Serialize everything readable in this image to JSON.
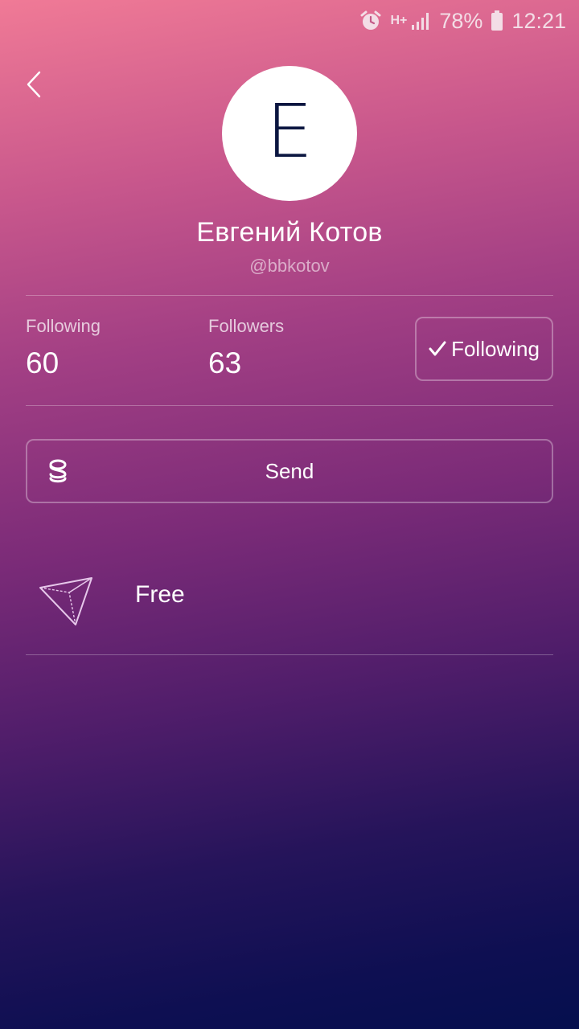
{
  "status_bar": {
    "network": "H+",
    "battery_percent": "78%",
    "time": "12:21"
  },
  "profile": {
    "avatar_initial": "E",
    "name": "Евгений Котов",
    "handle": "@bbkotov"
  },
  "stats": {
    "following_label": "Following",
    "following_count": "60",
    "followers_label": "Followers",
    "followers_count": "63"
  },
  "actions": {
    "following_button_label": "Following",
    "send_button_label": "Send"
  },
  "plan": {
    "label": "Free",
    "icon": "paper-plane-icon"
  },
  "icons": {
    "back": "chevron-left-icon",
    "send": "coin-icon",
    "check": "check-icon"
  }
}
